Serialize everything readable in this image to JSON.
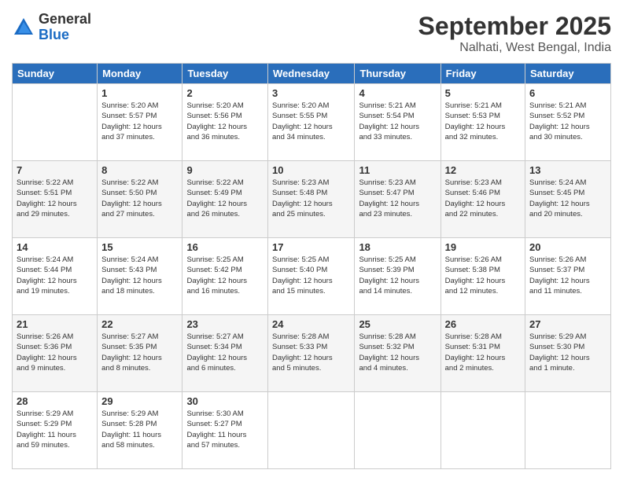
{
  "header": {
    "logo_general": "General",
    "logo_blue": "Blue",
    "month_title": "September 2025",
    "location": "Nalhati, West Bengal, India"
  },
  "weekdays": [
    "Sunday",
    "Monday",
    "Tuesday",
    "Wednesday",
    "Thursday",
    "Friday",
    "Saturday"
  ],
  "rows": [
    {
      "shade": "white",
      "cells": [
        {
          "day": "",
          "info": ""
        },
        {
          "day": "1",
          "info": "Sunrise: 5:20 AM\nSunset: 5:57 PM\nDaylight: 12 hours\nand 37 minutes."
        },
        {
          "day": "2",
          "info": "Sunrise: 5:20 AM\nSunset: 5:56 PM\nDaylight: 12 hours\nand 36 minutes."
        },
        {
          "day": "3",
          "info": "Sunrise: 5:20 AM\nSunset: 5:55 PM\nDaylight: 12 hours\nand 34 minutes."
        },
        {
          "day": "4",
          "info": "Sunrise: 5:21 AM\nSunset: 5:54 PM\nDaylight: 12 hours\nand 33 minutes."
        },
        {
          "day": "5",
          "info": "Sunrise: 5:21 AM\nSunset: 5:53 PM\nDaylight: 12 hours\nand 32 minutes."
        },
        {
          "day": "6",
          "info": "Sunrise: 5:21 AM\nSunset: 5:52 PM\nDaylight: 12 hours\nand 30 minutes."
        }
      ]
    },
    {
      "shade": "shaded",
      "cells": [
        {
          "day": "7",
          "info": "Sunrise: 5:22 AM\nSunset: 5:51 PM\nDaylight: 12 hours\nand 29 minutes."
        },
        {
          "day": "8",
          "info": "Sunrise: 5:22 AM\nSunset: 5:50 PM\nDaylight: 12 hours\nand 27 minutes."
        },
        {
          "day": "9",
          "info": "Sunrise: 5:22 AM\nSunset: 5:49 PM\nDaylight: 12 hours\nand 26 minutes."
        },
        {
          "day": "10",
          "info": "Sunrise: 5:23 AM\nSunset: 5:48 PM\nDaylight: 12 hours\nand 25 minutes."
        },
        {
          "day": "11",
          "info": "Sunrise: 5:23 AM\nSunset: 5:47 PM\nDaylight: 12 hours\nand 23 minutes."
        },
        {
          "day": "12",
          "info": "Sunrise: 5:23 AM\nSunset: 5:46 PM\nDaylight: 12 hours\nand 22 minutes."
        },
        {
          "day": "13",
          "info": "Sunrise: 5:24 AM\nSunset: 5:45 PM\nDaylight: 12 hours\nand 20 minutes."
        }
      ]
    },
    {
      "shade": "white",
      "cells": [
        {
          "day": "14",
          "info": "Sunrise: 5:24 AM\nSunset: 5:44 PM\nDaylight: 12 hours\nand 19 minutes."
        },
        {
          "day": "15",
          "info": "Sunrise: 5:24 AM\nSunset: 5:43 PM\nDaylight: 12 hours\nand 18 minutes."
        },
        {
          "day": "16",
          "info": "Sunrise: 5:25 AM\nSunset: 5:42 PM\nDaylight: 12 hours\nand 16 minutes."
        },
        {
          "day": "17",
          "info": "Sunrise: 5:25 AM\nSunset: 5:40 PM\nDaylight: 12 hours\nand 15 minutes."
        },
        {
          "day": "18",
          "info": "Sunrise: 5:25 AM\nSunset: 5:39 PM\nDaylight: 12 hours\nand 14 minutes."
        },
        {
          "day": "19",
          "info": "Sunrise: 5:26 AM\nSunset: 5:38 PM\nDaylight: 12 hours\nand 12 minutes."
        },
        {
          "day": "20",
          "info": "Sunrise: 5:26 AM\nSunset: 5:37 PM\nDaylight: 12 hours\nand 11 minutes."
        }
      ]
    },
    {
      "shade": "shaded",
      "cells": [
        {
          "day": "21",
          "info": "Sunrise: 5:26 AM\nSunset: 5:36 PM\nDaylight: 12 hours\nand 9 minutes."
        },
        {
          "day": "22",
          "info": "Sunrise: 5:27 AM\nSunset: 5:35 PM\nDaylight: 12 hours\nand 8 minutes."
        },
        {
          "day": "23",
          "info": "Sunrise: 5:27 AM\nSunset: 5:34 PM\nDaylight: 12 hours\nand 6 minutes."
        },
        {
          "day": "24",
          "info": "Sunrise: 5:28 AM\nSunset: 5:33 PM\nDaylight: 12 hours\nand 5 minutes."
        },
        {
          "day": "25",
          "info": "Sunrise: 5:28 AM\nSunset: 5:32 PM\nDaylight: 12 hours\nand 4 minutes."
        },
        {
          "day": "26",
          "info": "Sunrise: 5:28 AM\nSunset: 5:31 PM\nDaylight: 12 hours\nand 2 minutes."
        },
        {
          "day": "27",
          "info": "Sunrise: 5:29 AM\nSunset: 5:30 PM\nDaylight: 12 hours\nand 1 minute."
        }
      ]
    },
    {
      "shade": "white",
      "cells": [
        {
          "day": "28",
          "info": "Sunrise: 5:29 AM\nSunset: 5:29 PM\nDaylight: 11 hours\nand 59 minutes."
        },
        {
          "day": "29",
          "info": "Sunrise: 5:29 AM\nSunset: 5:28 PM\nDaylight: 11 hours\nand 58 minutes."
        },
        {
          "day": "30",
          "info": "Sunrise: 5:30 AM\nSunset: 5:27 PM\nDaylight: 11 hours\nand 57 minutes."
        },
        {
          "day": "",
          "info": ""
        },
        {
          "day": "",
          "info": ""
        },
        {
          "day": "",
          "info": ""
        },
        {
          "day": "",
          "info": ""
        }
      ]
    }
  ]
}
